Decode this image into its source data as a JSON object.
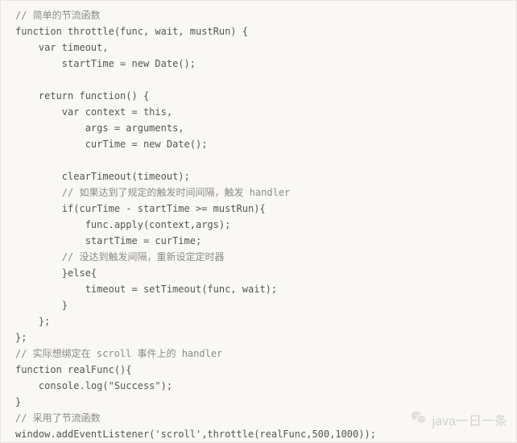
{
  "code": {
    "lines": [
      {
        "i": "",
        "t": "// 简单的节流函数",
        "cls": "cm"
      },
      {
        "i": "",
        "t": "function throttle(func, wait, mustRun) {",
        "cls": ""
      },
      {
        "i": "    ",
        "t": "var timeout,",
        "cls": ""
      },
      {
        "i": "        ",
        "t": "startTime = new Date();",
        "cls": ""
      },
      {
        "i": "",
        "t": "",
        "cls": ""
      },
      {
        "i": "    ",
        "t": "return function() {",
        "cls": ""
      },
      {
        "i": "        ",
        "t": "var context = this,",
        "cls": ""
      },
      {
        "i": "            ",
        "t": "args = arguments,",
        "cls": ""
      },
      {
        "i": "            ",
        "t": "curTime = new Date();",
        "cls": ""
      },
      {
        "i": "",
        "t": "",
        "cls": ""
      },
      {
        "i": "        ",
        "t": "clearTimeout(timeout);",
        "cls": ""
      },
      {
        "i": "        ",
        "t": "// 如果达到了规定的触发时间间隔，触发 handler",
        "cls": "cm"
      },
      {
        "i": "        ",
        "t": "if(curTime - startTime >= mustRun){",
        "cls": ""
      },
      {
        "i": "            ",
        "t": "func.apply(context,args);",
        "cls": ""
      },
      {
        "i": "            ",
        "t": "startTime = curTime;",
        "cls": ""
      },
      {
        "i": "        ",
        "t": "// 没达到触发间隔，重新设定定时器",
        "cls": "cm"
      },
      {
        "i": "        ",
        "t": "}else{",
        "cls": ""
      },
      {
        "i": "            ",
        "t": "timeout = setTimeout(func, wait);",
        "cls": ""
      },
      {
        "i": "        ",
        "t": "}",
        "cls": ""
      },
      {
        "i": "    ",
        "t": "};",
        "cls": ""
      },
      {
        "i": "",
        "t": "};",
        "cls": ""
      },
      {
        "i": "",
        "t": "// 实际想绑定在 scroll 事件上的 handler",
        "cls": "cm"
      },
      {
        "i": "",
        "t": "function realFunc(){",
        "cls": ""
      },
      {
        "i": "    ",
        "t": "console.log(\"Success\");",
        "cls": ""
      },
      {
        "i": "",
        "t": "}",
        "cls": ""
      },
      {
        "i": "",
        "t": "// 采用了节流函数",
        "cls": "cm"
      },
      {
        "i": "",
        "t": "window.addEventListener('scroll',throttle(realFunc,500,1000));",
        "cls": ""
      }
    ]
  },
  "watermark": {
    "text": "java一日一条"
  }
}
